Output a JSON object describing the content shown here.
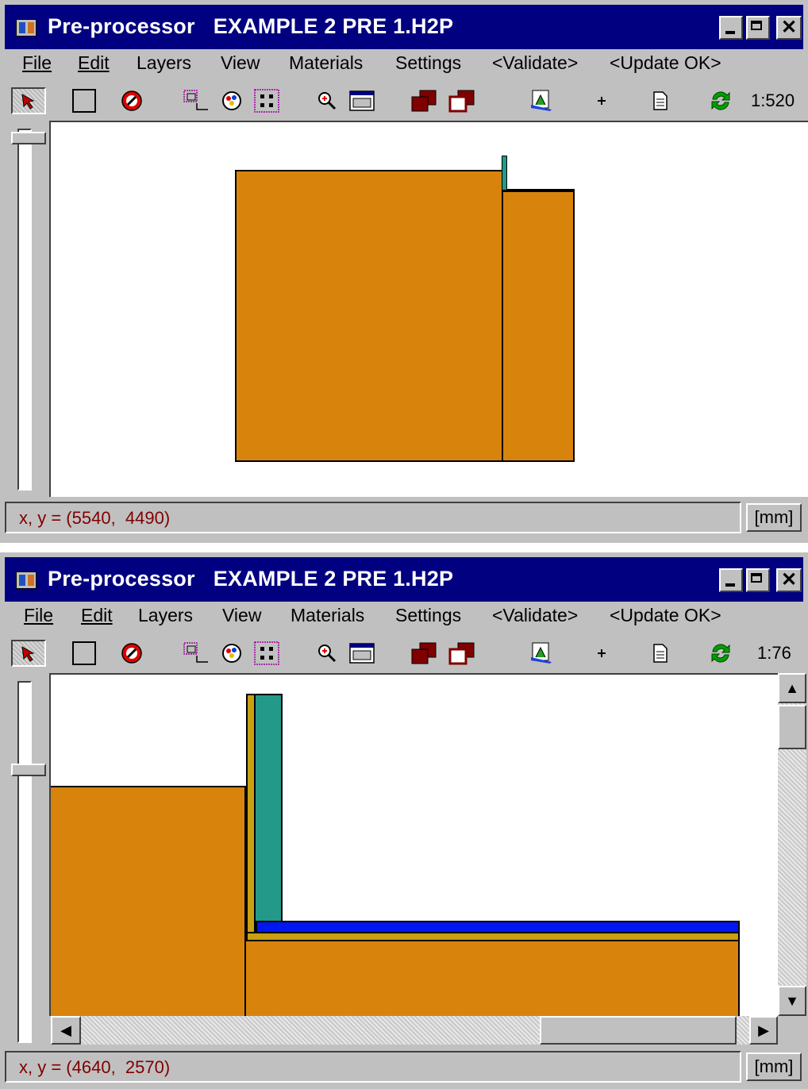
{
  "windows": [
    {
      "title": "Pre-processor   EXAMPLE 2 PRE 1.H2P",
      "menu": [
        "File",
        "Edit",
        "Layers",
        "View",
        "Materials",
        "Settings",
        "<Validate>",
        "<Update OK>"
      ],
      "toolbar": {
        "scale": "1:520"
      },
      "status": {
        "coords": "x, y = (5540,  4490)",
        "units": "[mm]"
      }
    },
    {
      "title": "Pre-processor   EXAMPLE 2 PRE 1.H2P",
      "menu": [
        "File",
        "Edit",
        "Layers",
        "View",
        "Materials",
        "Settings",
        "<Validate>",
        "<Update OK>"
      ],
      "toolbar": {
        "scale": "1:76"
      },
      "status": {
        "coords": "x, y = (4640,  2570)",
        "units": "[mm]"
      }
    }
  ],
  "colors": {
    "title_bar": "#000080",
    "chrome": "#c0c0c0",
    "material_orange": "#d8840c",
    "material_teal": "#23998a",
    "material_gold": "#c8a012",
    "material_blue": "#0018f0",
    "status_text": "#800000"
  },
  "icons": [
    "app-icon",
    "select-arrow-icon",
    "rectangle-icon",
    "no-entry-icon",
    "snap-grid-icon",
    "palette-icon",
    "points-icon",
    "zoom-in-icon",
    "zoom-window-icon",
    "bring-front-icon",
    "send-back-icon",
    "export-icon",
    "plus-icon",
    "document-icon",
    "refresh-icon"
  ]
}
